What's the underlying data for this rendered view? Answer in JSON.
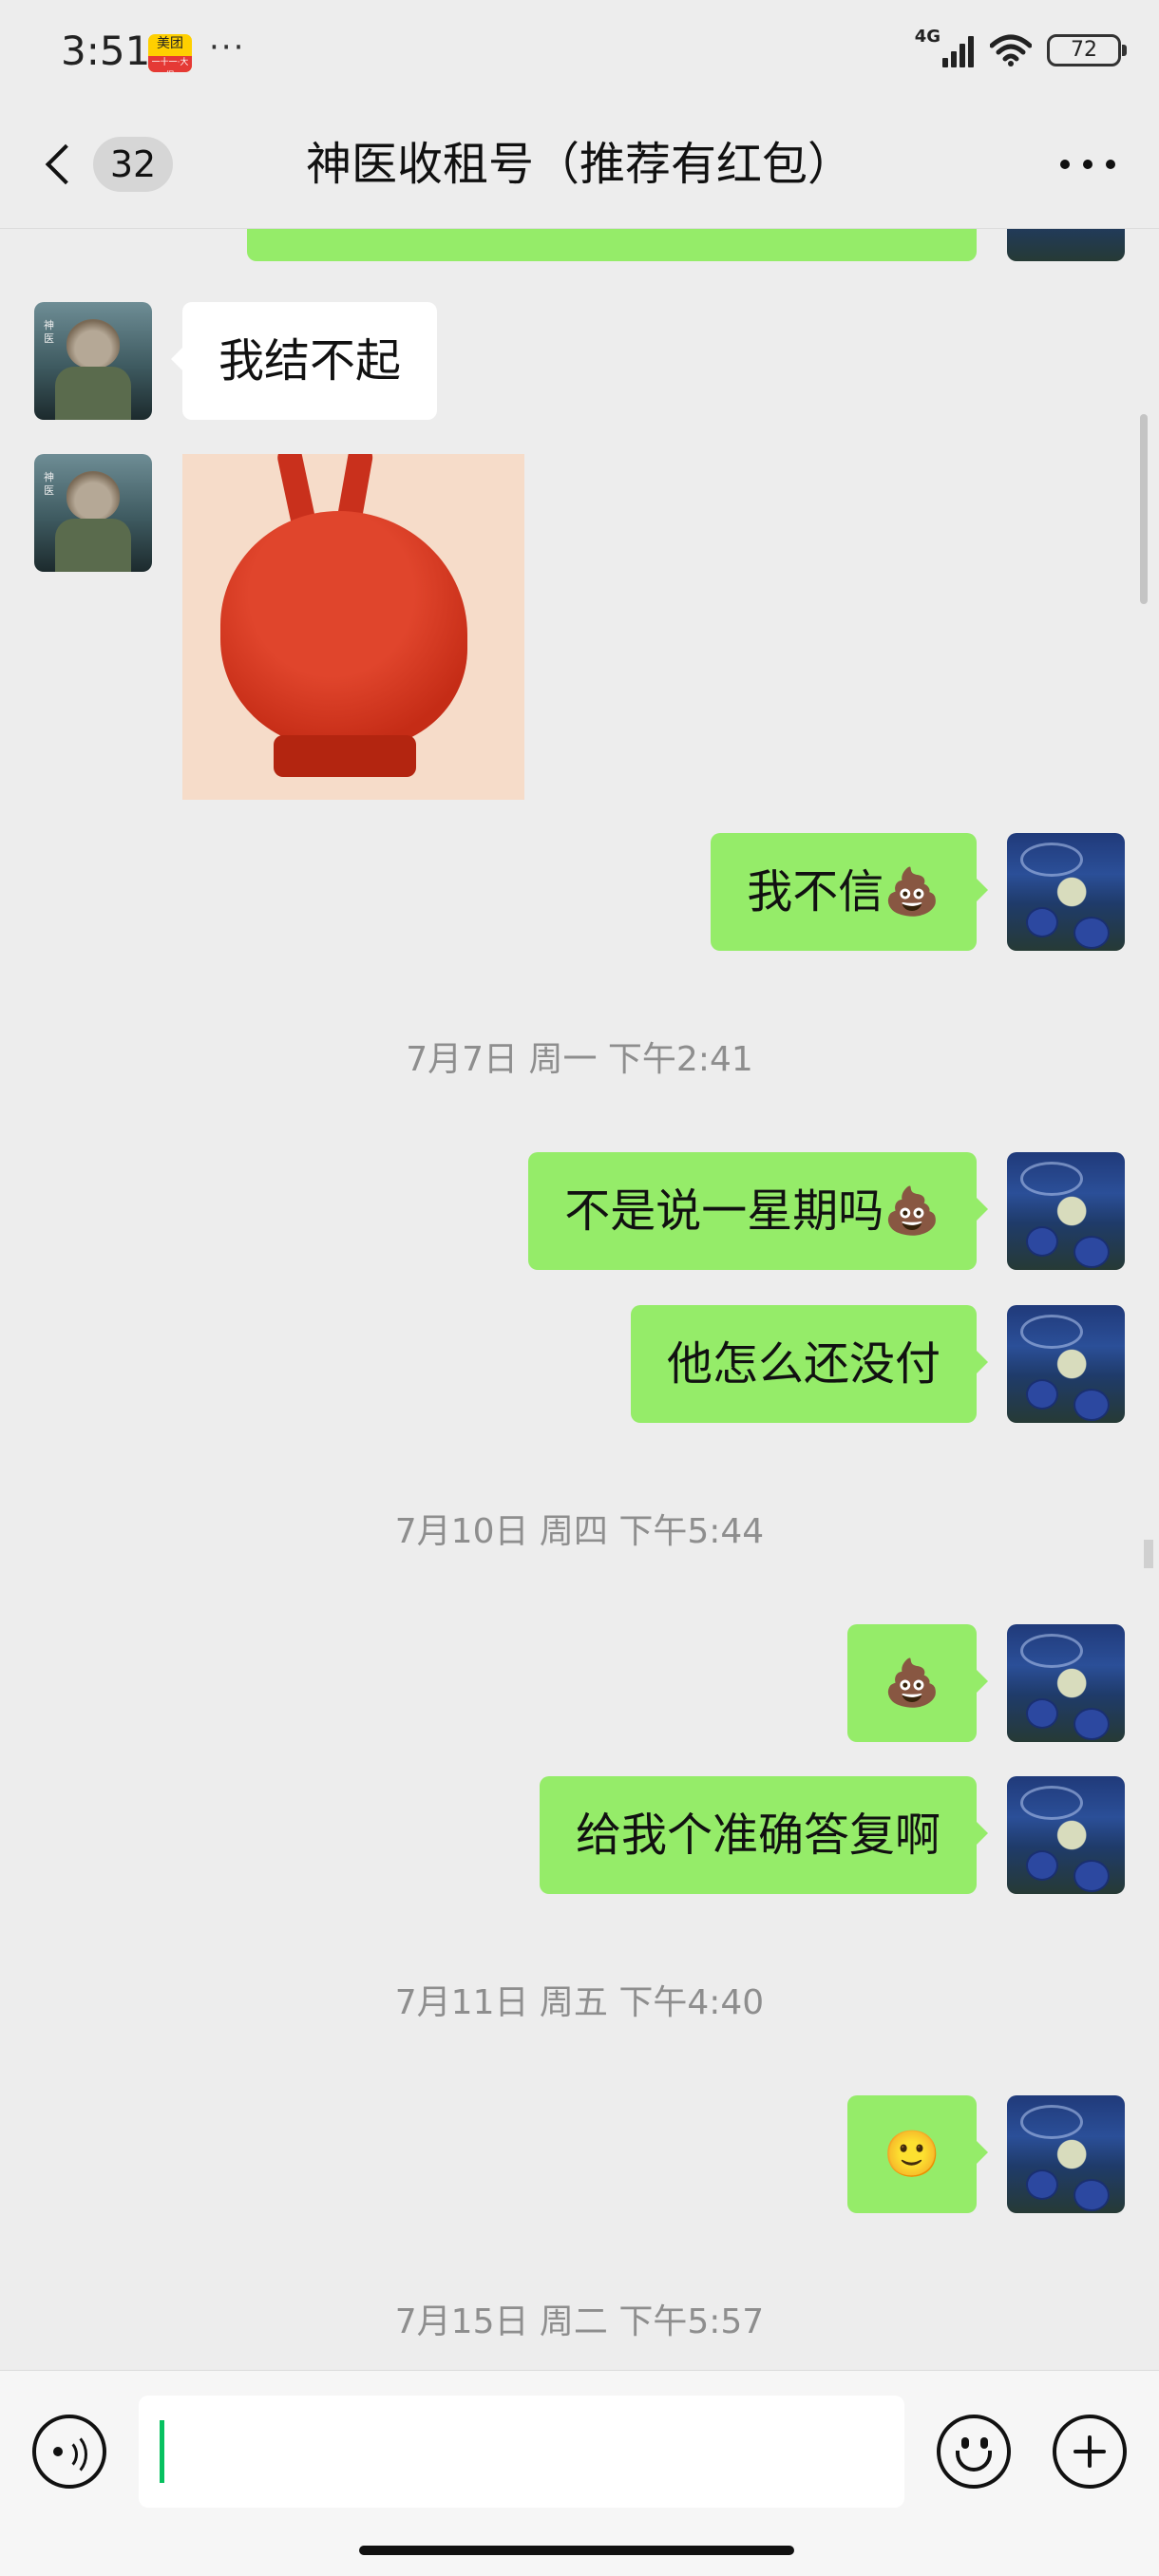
{
  "status_bar": {
    "time": "3:51",
    "app_badge_top": "美团",
    "app_badge_bottom": "一十一·大促",
    "more_dots": "···",
    "network": "4G",
    "battery": "72"
  },
  "header": {
    "unread_count": "32",
    "title": "神医收租号（推荐有红包）",
    "more_icon": "more-dots-icon"
  },
  "avatars": {
    "peer_tag": "神医"
  },
  "messages": [
    {
      "sender": "peer",
      "type": "text",
      "text": "我结不起"
    },
    {
      "sender": "peer",
      "type": "sticker",
      "sticker_icon": "red-bunny-sticker"
    },
    {
      "sender": "self",
      "type": "text",
      "text": "我不信💩"
    },
    {
      "type": "timestamp",
      "text": "7月7日 周一 下午2:41"
    },
    {
      "sender": "self",
      "type": "text",
      "text": "不是说一星期吗💩"
    },
    {
      "sender": "self",
      "type": "text",
      "text": "他怎么还没付"
    },
    {
      "type": "timestamp",
      "text": "7月10日 周四 下午5:44"
    },
    {
      "sender": "self",
      "type": "text",
      "text": "💩"
    },
    {
      "sender": "self",
      "type": "text",
      "text": "给我个准确答复啊"
    },
    {
      "type": "timestamp",
      "text": "7月11日 周五 下午4:40"
    },
    {
      "sender": "self",
      "type": "text",
      "text": "🙂"
    },
    {
      "type": "timestamp",
      "text": "7月15日 周二 下午5:57"
    }
  ],
  "input_bar": {
    "voice_icon": "voice-icon",
    "text_value": "",
    "emoji_icon": "emoji-icon",
    "plus_icon": "plus-icon"
  },
  "colors": {
    "background": "#ededed",
    "self_bubble": "#95ec69",
    "peer_bubble": "#ffffff",
    "timestamp_text": "#8e8e8e",
    "caret": "#07c160"
  }
}
